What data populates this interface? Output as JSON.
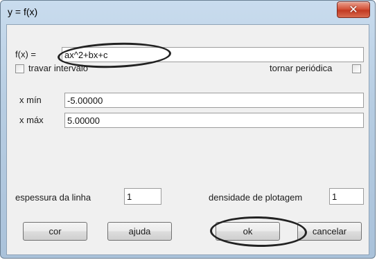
{
  "window": {
    "title": "y = f(x)",
    "close_icon": "close-icon"
  },
  "function": {
    "label": "f(x) =",
    "value": "ax^2+bx+c"
  },
  "options": {
    "lock_interval_label": "travar intervalo",
    "lock_interval_checked": false,
    "periodic_label": "tornar periódica",
    "periodic_checked": false
  },
  "range": {
    "xmin_label": "x mín",
    "xmin_value": "-5.00000",
    "xmax_label": "x máx",
    "xmax_value": "5.00000"
  },
  "line": {
    "thickness_label": "espessura da linha",
    "thickness_value": "1"
  },
  "plot": {
    "density_label": "densidade de plotagem",
    "density_value": "1"
  },
  "buttons": {
    "color": "cor",
    "help": "ajuda",
    "ok": "ok",
    "cancel": "cancelar"
  }
}
